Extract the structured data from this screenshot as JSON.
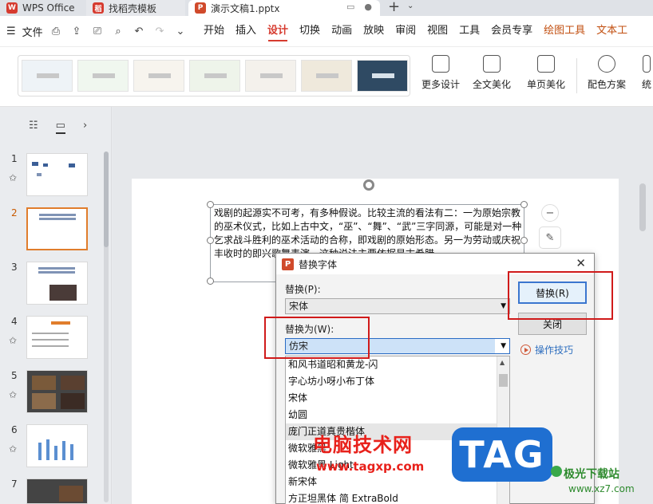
{
  "tabs": {
    "wps": "WPS Office",
    "template": "找稻壳模板",
    "doc": "演示文稿1.pptx"
  },
  "menubar": {
    "file": "文件",
    "items": [
      "开始",
      "插入",
      "设计",
      "切换",
      "动画",
      "放映",
      "审阅",
      "视图",
      "工具",
      "会员专享",
      "绘图工具",
      "文本工"
    ],
    "active": "设计"
  },
  "ribbon": {
    "more_design": "更多设计",
    "beautify_all": "全文美化",
    "single_page": "单页美化",
    "color_scheme": "配色方案",
    "unify": "统"
  },
  "slides": [
    {
      "num": "1"
    },
    {
      "num": "2"
    },
    {
      "num": "3"
    },
    {
      "num": "4"
    },
    {
      "num": "5"
    },
    {
      "num": "6"
    },
    {
      "num": "7"
    }
  ],
  "slide_text": "戏剧的起源实不可考，有多种假说。比较主流的看法有二：一为原始宗教的巫术仪式，比如上古中文，“巫”、“舞”、“武”三字同源，可能是对一种乞求战斗胜利的巫术活动的合称，即戏剧的原始形态。另一为劳动或庆祝丰收时的即兴歌舞表演，这种说法主要依据是古希腊",
  "dialog": {
    "title": "替换字体",
    "replace_label": "替换(P):",
    "replace_value": "宋体",
    "with_label": "替换为(W):",
    "with_value": "仿宋",
    "font_list": [
      "和风书道昭和黄龙-闪",
      "字心坊小呀小布丁体",
      "宋体",
      "幼圆",
      "庞门正道真贵楷体",
      "微软雅黑",
      "微软雅黑 Light",
      "新宋体",
      "方正坦黑体 简 ExtraBold"
    ],
    "replace_button": "替换(R)",
    "close_button": "关闭",
    "tips": "操作技巧"
  },
  "watermark": {
    "text": "电脑技术网",
    "url": "www.tagxp.com",
    "tag": "TAG",
    "site": "极光下载站",
    "site_url": "www.xz7.com"
  }
}
